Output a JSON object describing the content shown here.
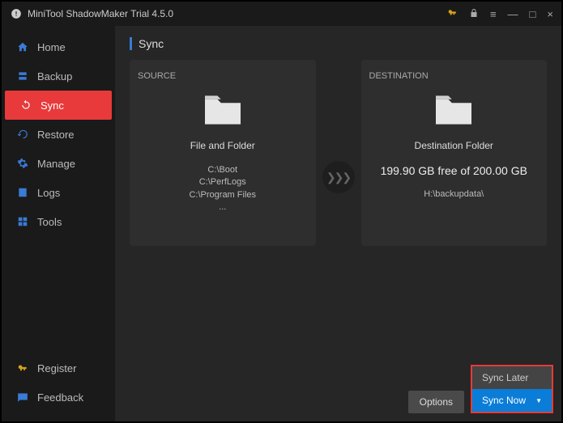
{
  "titlebar": {
    "title": "MiniTool ShadowMaker Trial 4.5.0"
  },
  "sidebar": {
    "items": [
      {
        "label": "Home"
      },
      {
        "label": "Backup"
      },
      {
        "label": "Sync"
      },
      {
        "label": "Restore"
      },
      {
        "label": "Manage"
      },
      {
        "label": "Logs"
      },
      {
        "label": "Tools"
      }
    ],
    "bottom": [
      {
        "label": "Register"
      },
      {
        "label": "Feedback"
      }
    ]
  },
  "page": {
    "title": "Sync"
  },
  "source": {
    "heading": "SOURCE",
    "label": "File and Folder",
    "paths": [
      "C:\\Boot",
      "C:\\PerfLogs",
      "C:\\Program Files",
      "..."
    ]
  },
  "destination": {
    "heading": "DESTINATION",
    "label": "Destination Folder",
    "storage": "199.90 GB free of 200.00 GB",
    "path": "H:\\backupdata\\"
  },
  "footer": {
    "options": "Options",
    "sync_later": "Sync Later",
    "sync_now": "Sync Now"
  }
}
